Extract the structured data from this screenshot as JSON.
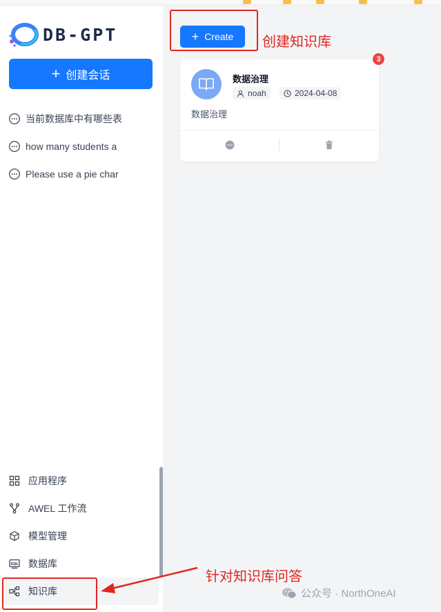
{
  "app": {
    "logo_text": "DB-GPT"
  },
  "sidebar": {
    "new_chat_label": "创建会话",
    "history": [
      {
        "label": "当前数据库中有哪些表"
      },
      {
        "label": "how many students a"
      },
      {
        "label": "Please use a pie char"
      }
    ],
    "menu": [
      {
        "label": "应用程序",
        "icon": "apps-grid-icon"
      },
      {
        "label": "AWEL 工作流",
        "icon": "workflow-icon"
      },
      {
        "label": "模型管理",
        "icon": "cube-icon"
      },
      {
        "label": "数据库",
        "icon": "sql-database-icon"
      },
      {
        "label": "知识库",
        "icon": "knowledge-graph-icon",
        "active": true
      }
    ]
  },
  "main": {
    "create_label": "Create",
    "card": {
      "title": "数据治理",
      "owner": "noah",
      "date": "2024-04-08",
      "description": "数据治理",
      "badge_count": "3"
    }
  },
  "annotations": {
    "create_note": "创建知识库",
    "knowledge_note": "针对知识库问答",
    "watermark": "公众号 · NorthOneAI"
  },
  "colors": {
    "primary": "#1677ff",
    "annotation_red": "#e0261f",
    "avatar_blue": "#7aa9f5",
    "badge_red": "#ef4444"
  }
}
